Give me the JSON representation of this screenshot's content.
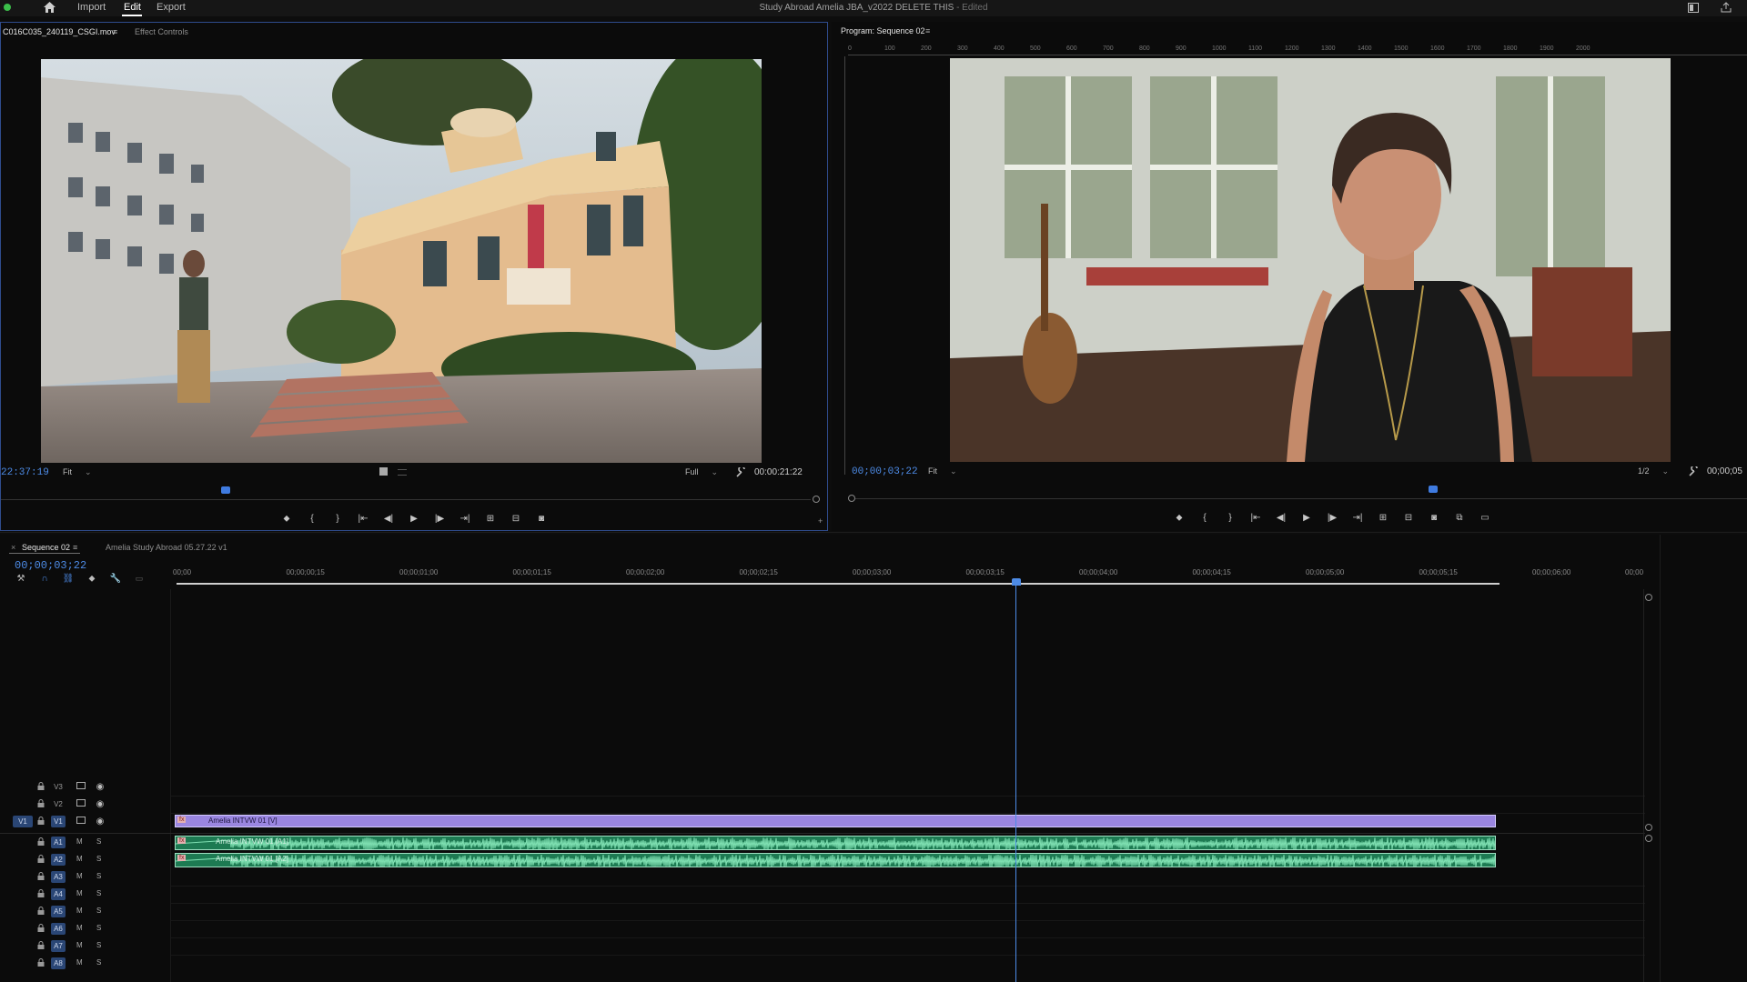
{
  "app": {
    "menu": [
      "Import",
      "Edit",
      "Export"
    ],
    "active_menu": "Edit",
    "doc_title": "Study Abroad Amelia JBA_v2022 DELETE THIS",
    "doc_status": "- Edited"
  },
  "source": {
    "tab_clip": "C016C035_240119_CSGI.mov",
    "tab_effects": "Effect Controls",
    "timecode_current": "22:37:19",
    "zoom": "Fit",
    "resolution": "Full",
    "duration": "00:00:21:22"
  },
  "program": {
    "tab": "Program: Sequence 02",
    "timecode_current": "00;00;03;22",
    "zoom": "Fit",
    "resolution": "1/2",
    "duration": "00;00;05",
    "ruler_labels": [
      "0",
      "100",
      "200",
      "300",
      "400",
      "500",
      "600",
      "700",
      "800",
      "900",
      "1000",
      "1100",
      "1200",
      "1300",
      "1400",
      "1500",
      "1600",
      "1700",
      "1800",
      "1900",
      "2000"
    ]
  },
  "timeline": {
    "tab_sequence": "Sequence 02",
    "tab_other": "Amelia Study Abroad 05.27.22 v1",
    "timecode": "00;00;03;22",
    "ruler_ticks": [
      "00;00",
      "00;00;00;15",
      "00;00;01;00",
      "00;00;01;15",
      "00;00;02;00",
      "00;00;02;15",
      "00;00;03;00",
      "00;00;03;15",
      "00;00;04;00",
      "00;00;04;15",
      "00;00;05;00",
      "00;00;05;15",
      "00;00;06;00",
      "00;00"
    ],
    "video_tracks": [
      {
        "name": "V3",
        "target": ""
      },
      {
        "name": "V2",
        "target": ""
      },
      {
        "name": "V1",
        "target": "V1"
      }
    ],
    "audio_tracks": [
      "A1",
      "A2",
      "A3",
      "A4",
      "A5",
      "A6",
      "A7",
      "A8"
    ],
    "mute_label": "M",
    "solo_label": "S",
    "clips": {
      "video_v1": "Amelia INTVW 01 [V]",
      "audio_a1": "Amelia INTVW 01 [A1]",
      "audio_a2": "Amelia INTVW 01 [A2]",
      "fx_badge": "fx"
    },
    "colors": {
      "video_clip": "#9a86e0",
      "audio_clip": "#1d7a52",
      "playhead": "#4d8be6"
    }
  }
}
